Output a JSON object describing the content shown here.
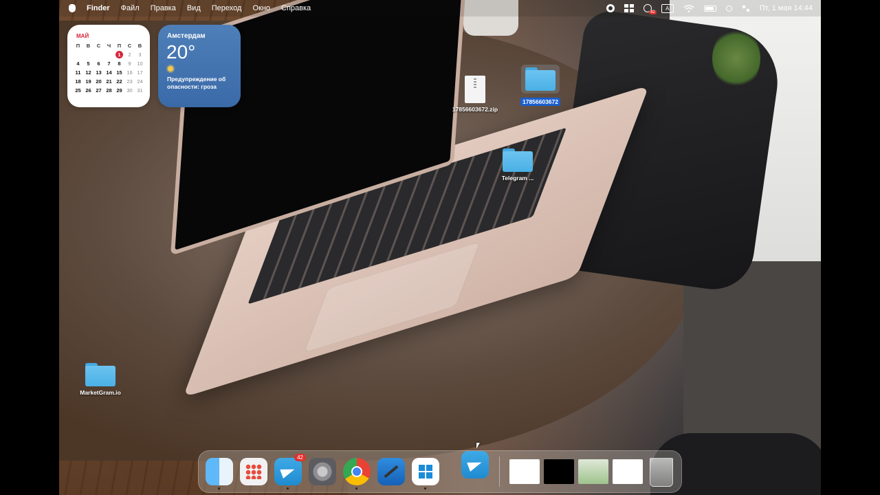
{
  "menubar": {
    "app_name": "Finder",
    "menus": [
      "Файл",
      "Правка",
      "Вид",
      "Переход",
      "Окно",
      "Справка"
    ],
    "telegram_badge": "42",
    "input_source": "A",
    "clock": "Пт, 1 мая  14:44"
  },
  "calendar_widget": {
    "month": "МАЙ",
    "weekdays": [
      "П",
      "В",
      "С",
      "Ч",
      "П",
      "С",
      "В"
    ],
    "today": "1",
    "rows": [
      [
        "",
        "",
        "",
        "",
        "1",
        "2",
        "3"
      ],
      [
        "4",
        "5",
        "6",
        "7",
        "8",
        "9",
        "10"
      ],
      [
        "11",
        "12",
        "13",
        "14",
        "15",
        "16",
        "17"
      ],
      [
        "18",
        "19",
        "20",
        "21",
        "22",
        "23",
        "24"
      ],
      [
        "25",
        "26",
        "27",
        "28",
        "29",
        "30",
        "31"
      ]
    ]
  },
  "weather_widget": {
    "city": "Амстердам",
    "temperature": "20°",
    "alert": "Предупреждение об опасности: гроза"
  },
  "desktop_icons": {
    "zip": "17856603672.zip",
    "folder_selected": "17856603672",
    "telegram_folder": "Telegram ...",
    "marketgram_folder": "MarketGram.io"
  },
  "dock": {
    "telegram_badge": "42",
    "apps": [
      "finder",
      "launchpad",
      "telegram",
      "system-settings",
      "chrome",
      "xcode",
      "windows-app",
      "telegram",
      "document-thumbnail",
      "terminal-thumbnail",
      "telegram-window-thumbnail",
      "chrome-window-thumbnail",
      "trash"
    ]
  },
  "colors": {
    "selection": "#1a5fd0",
    "calendar_accent": "#d6243a",
    "weather_bg": "#4f7fb8",
    "badge": "#e0302e"
  }
}
